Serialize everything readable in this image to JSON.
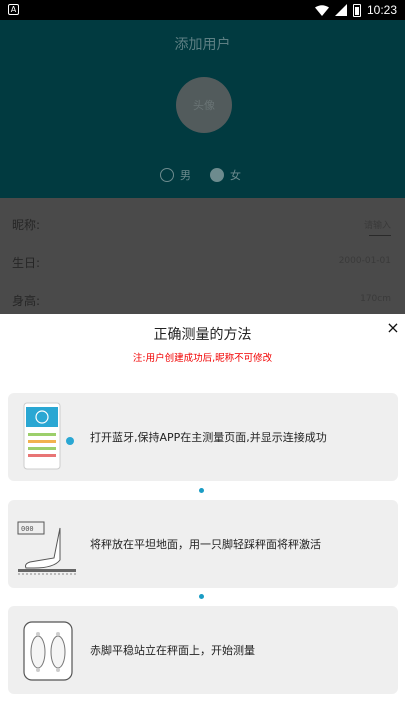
{
  "status_bar": {
    "time": "10:23",
    "left_icon": "A"
  },
  "background_page": {
    "title": "添加用户",
    "avatar_text": "头像",
    "gender_male": "男",
    "gender_female": "女",
    "rows": [
      {
        "label": "昵称:",
        "value": "请输入"
      },
      {
        "label": "生日:",
        "value": "2000-01-01"
      },
      {
        "label": "身高:",
        "value": "170cm"
      }
    ]
  },
  "sheet": {
    "title": "正确测量的方法",
    "close_icon": "×",
    "note": "注:用户创建成功后,昵称不可修改",
    "steps": [
      {
        "text": "打开蓝牙,保持APP在主测量页面,并显示连接成功"
      },
      {
        "text": "将秤放在平坦地面，用一只脚轻踩秤面将秤激活"
      },
      {
        "text": "赤脚平稳站立在秤面上，开始测量"
      }
    ]
  },
  "colors": {
    "accent": "#1a9cc4",
    "note_red": "#f10000",
    "header_bg": "#013a40"
  }
}
